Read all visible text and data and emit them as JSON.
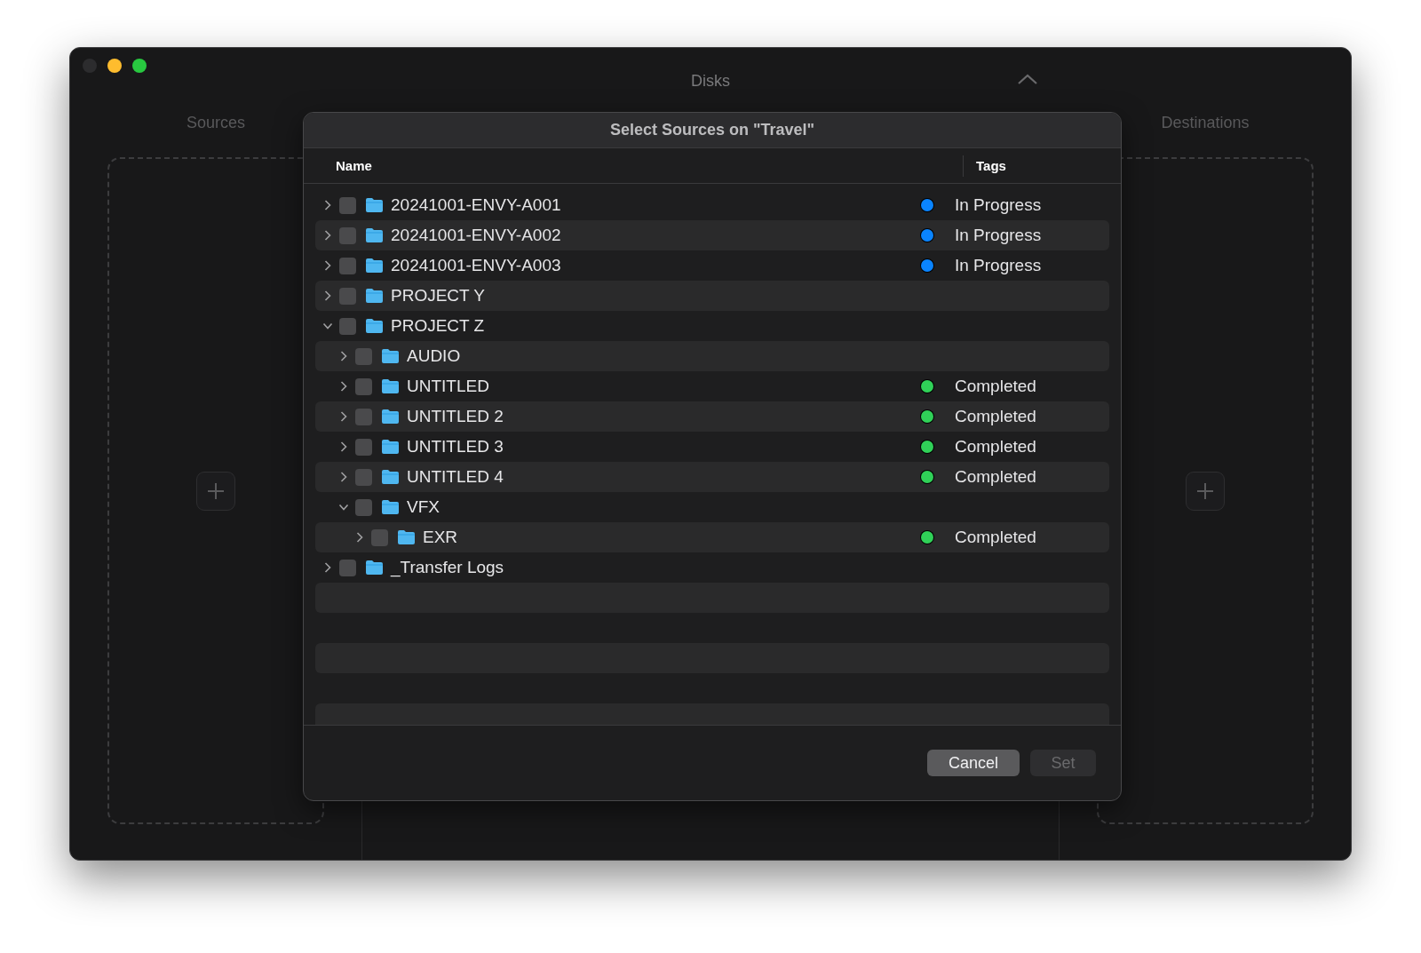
{
  "window": {
    "title": "Disks"
  },
  "sources": {
    "label": "Sources"
  },
  "destinations": {
    "label": "Destinations"
  },
  "dialog": {
    "title": "Select Sources on \"Travel\"",
    "columns": [
      "Name",
      "Tags"
    ],
    "items": [
      {
        "name": "20241001-ENVY-A001",
        "expanded": false,
        "checked": false,
        "tag": {
          "label": "In Progress",
          "color": "#0a84ff"
        }
      },
      {
        "name": "20241001-ENVY-A002",
        "expanded": false,
        "checked": false,
        "tag": {
          "label": "In Progress",
          "color": "#0a84ff"
        }
      },
      {
        "name": "20241001-ENVY-A003",
        "expanded": false,
        "checked": false,
        "tag": {
          "label": "In Progress",
          "color": "#0a84ff"
        }
      },
      {
        "name": "PROJECT Y",
        "expanded": false,
        "checked": false
      },
      {
        "name": "PROJECT Z",
        "expanded": true,
        "checked": false,
        "children": [
          {
            "name": "AUDIO",
            "expanded": false,
            "checked": false
          },
          {
            "name": "UNTITLED",
            "expanded": false,
            "checked": false,
            "tag": {
              "label": "Completed",
              "color": "#30d158"
            }
          },
          {
            "name": "UNTITLED 2",
            "expanded": false,
            "checked": false,
            "tag": {
              "label": "Completed",
              "color": "#30d158"
            }
          },
          {
            "name": "UNTITLED 3",
            "expanded": false,
            "checked": false,
            "tag": {
              "label": "Completed",
              "color": "#30d158"
            }
          },
          {
            "name": "UNTITLED 4",
            "expanded": false,
            "checked": false,
            "tag": {
              "label": "Completed",
              "color": "#30d158"
            }
          },
          {
            "name": "VFX",
            "expanded": true,
            "checked": false,
            "children": [
              {
                "name": "EXR",
                "expanded": false,
                "checked": false,
                "tag": {
                  "label": "Completed",
                  "color": "#30d158"
                }
              }
            ]
          }
        ]
      },
      {
        "name": "_Transfer Logs",
        "expanded": false,
        "checked": false
      }
    ],
    "buttons": [
      {
        "label": "Cancel",
        "disabled": false
      },
      {
        "label": "Set",
        "disabled": true
      }
    ]
  }
}
